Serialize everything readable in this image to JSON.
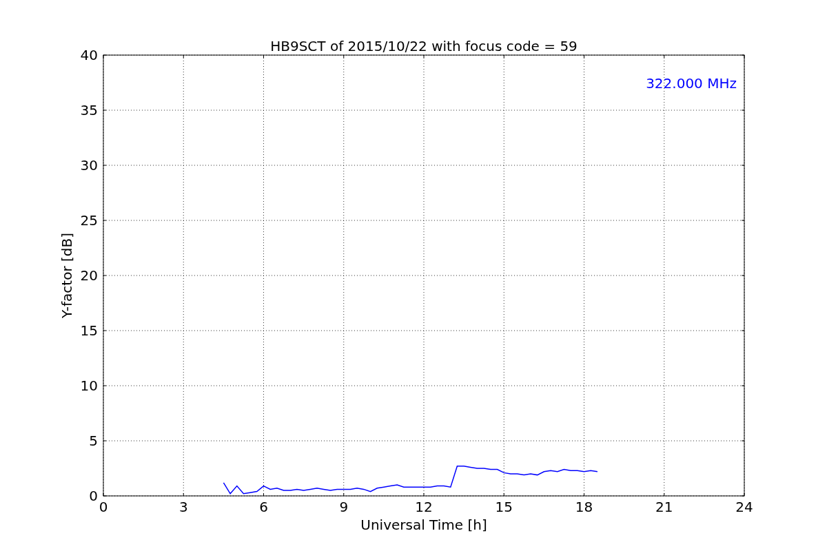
{
  "figure": {
    "chart_data": {
      "type": "line",
      "title": "HB9SCT of 2015/10/22 with focus code = 59",
      "xlabel": "Universal Time [h]",
      "ylabel": "Y-factor [dB]",
      "xlim": [
        0,
        24
      ],
      "ylim": [
        0,
        40
      ],
      "xticks": [
        0,
        3,
        6,
        9,
        12,
        15,
        18,
        21,
        24
      ],
      "yticks": [
        0,
        5,
        10,
        15,
        20,
        25,
        30,
        35,
        40
      ],
      "x": [
        4.5,
        4.75,
        5,
        5.25,
        5.5,
        5.75,
        6,
        6.25,
        6.5,
        6.75,
        7,
        7.25,
        7.5,
        7.75,
        8,
        8.25,
        8.5,
        8.75,
        9,
        9.25,
        9.5,
        9.75,
        10,
        10.25,
        10.5,
        10.75,
        11,
        11.25,
        11.5,
        11.75,
        12,
        12.25,
        12.5,
        12.75,
        13,
        13.25,
        13.5,
        13.75,
        14,
        14.25,
        14.5,
        14.75,
        15,
        15.25,
        15.5,
        15.75,
        16,
        16.25,
        16.5,
        16.75,
        17,
        17.25,
        17.5,
        17.75,
        18,
        18.25,
        18.5
      ],
      "series": [
        {
          "name": "322.000 MHz",
          "color": "#0000ff",
          "values": [
            1.2,
            0.2,
            0.9,
            0.2,
            0.3,
            0.4,
            0.9,
            0.6,
            0.7,
            0.5,
            0.5,
            0.6,
            0.5,
            0.6,
            0.7,
            0.6,
            0.5,
            0.6,
            0.6,
            0.6,
            0.7,
            0.6,
            0.4,
            0.7,
            0.8,
            0.9,
            1.0,
            0.8,
            0.8,
            0.8,
            0.8,
            0.8,
            0.9,
            0.9,
            0.8,
            2.7,
            2.7,
            2.6,
            2.5,
            2.5,
            2.4,
            2.4,
            2.1,
            2.0,
            2.0,
            1.9,
            2.0,
            1.9,
            2.2,
            2.3,
            2.2,
            2.4,
            2.3,
            2.3,
            2.2,
            2.3,
            2.2
          ]
        }
      ],
      "grid": true
    }
  }
}
